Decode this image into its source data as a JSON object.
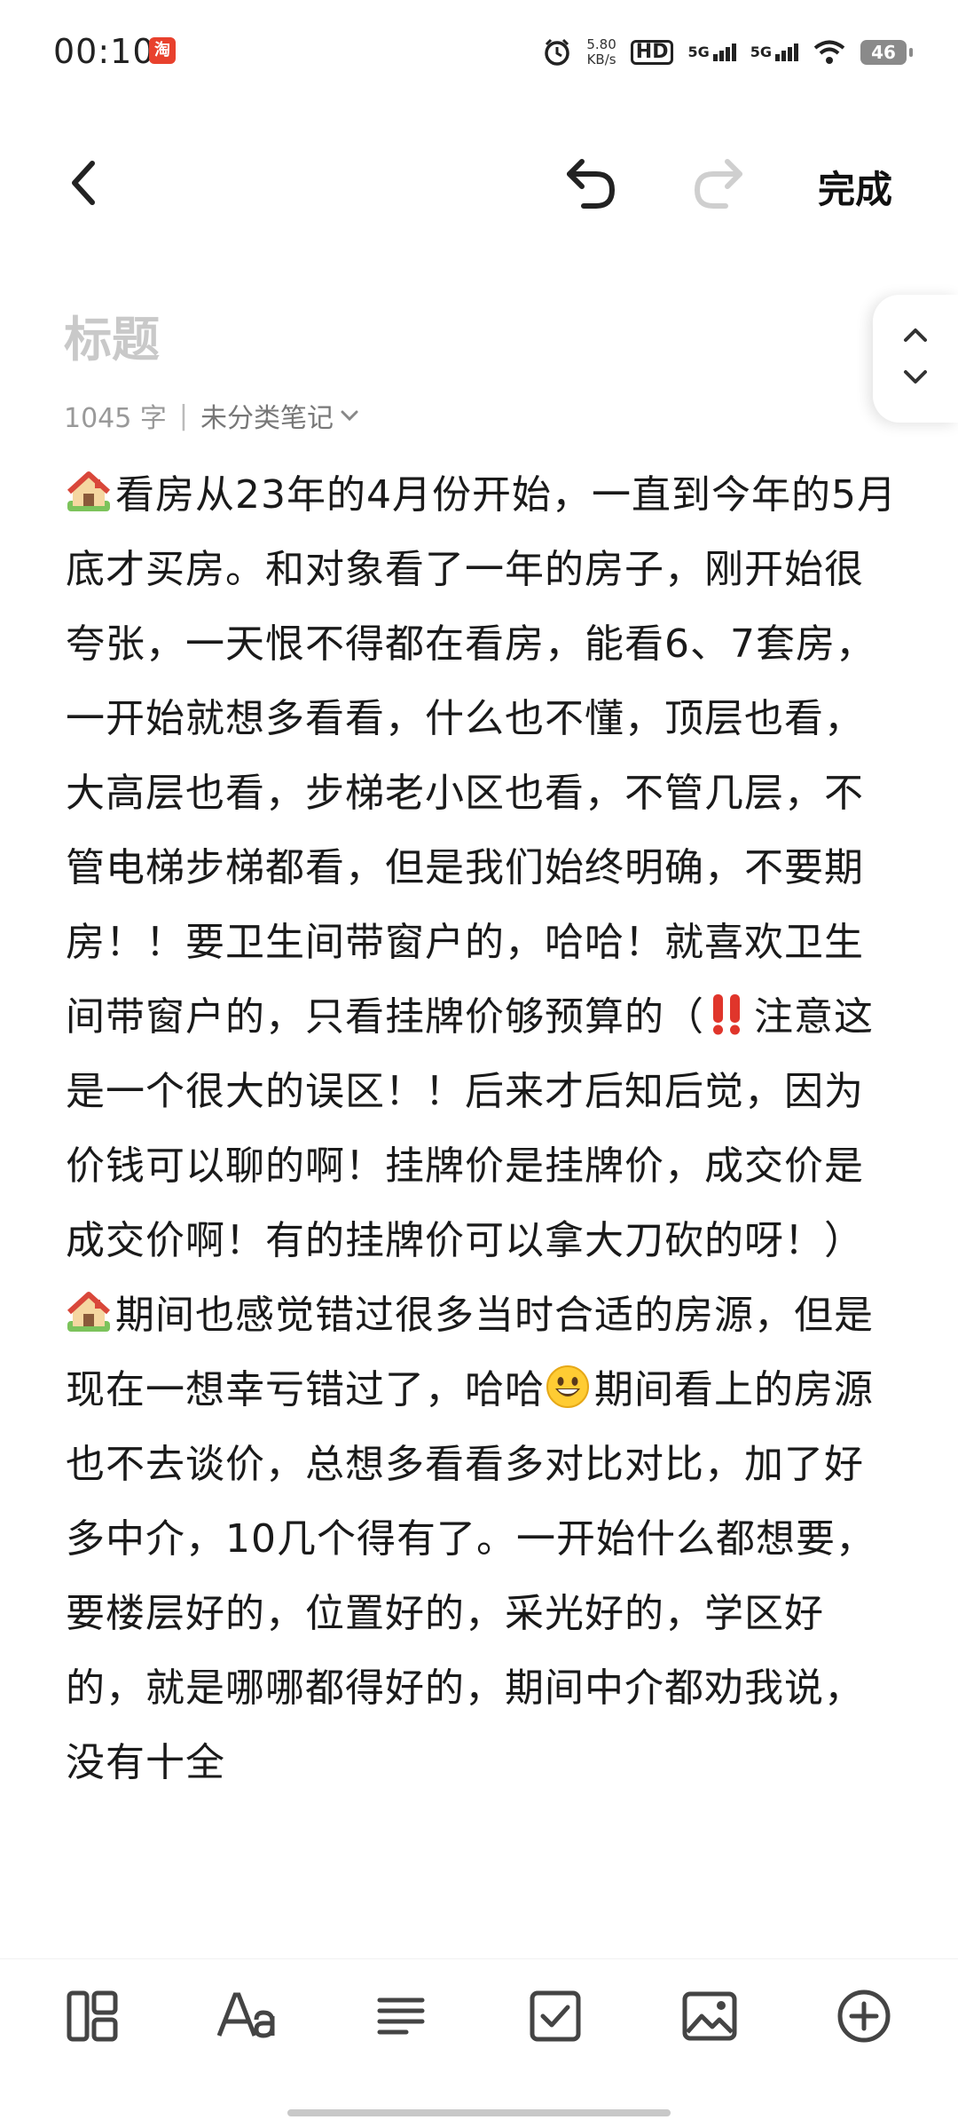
{
  "status_bar": {
    "time": "00:10",
    "app_badge": "淘",
    "net_speed_value": "5.80",
    "net_speed_unit": "KB/s",
    "hd_label": "HD",
    "signal_1": "5G",
    "signal_2": "5G",
    "battery": "46"
  },
  "toolbar": {
    "back_icon": "chevron-left",
    "undo_icon": "undo-arrow",
    "redo_icon": "redo-arrow",
    "done_label": "完成"
  },
  "note": {
    "title_placeholder": "标题",
    "word_count": "1045 字",
    "category": "未分类笔记",
    "paragraph_1": "看房从23年的4月份开始，一直到今年的5月底才买房。和对象看了一年的房子，刚开始很夸张，一天恨不得都在看房，能看6、7套房，一开始就想多看看，什么也不懂，顶层也看，大高层也看，步梯老小区也看，不管几层，不管电梯步梯都看，但是我们始终明确，不要期房！！要卫生间带窗户的，哈哈！就喜欢卫生间带窗户的，只看挂牌价够预算的（",
    "paragraph_1_tail": "注意这是一个很大的误区！！后来才后知后觉，因为价钱可以聊的啊！挂牌价是挂牌价，成交价是成交价啊！有的挂牌价可以拿大刀砍的呀！）",
    "paragraph_2": "期间也感觉错过很多当时合适的房源，但是现在一想幸亏错过了，哈哈",
    "paragraph_2_tail": "期间看上的房源也不去谈价，总想多看看多对比对比，加了好多中介，10几个得有了。一开始什么都想要，要楼层好的，位置好的，采光好的，学区好的，就是哪哪都得好的，期间中介都劝我说，没有十全"
  },
  "bottom_bar": {
    "icons": [
      "layout-icon",
      "font-icon",
      "paragraph-align-icon",
      "checkbox-icon",
      "image-icon",
      "add-circle-icon"
    ]
  }
}
